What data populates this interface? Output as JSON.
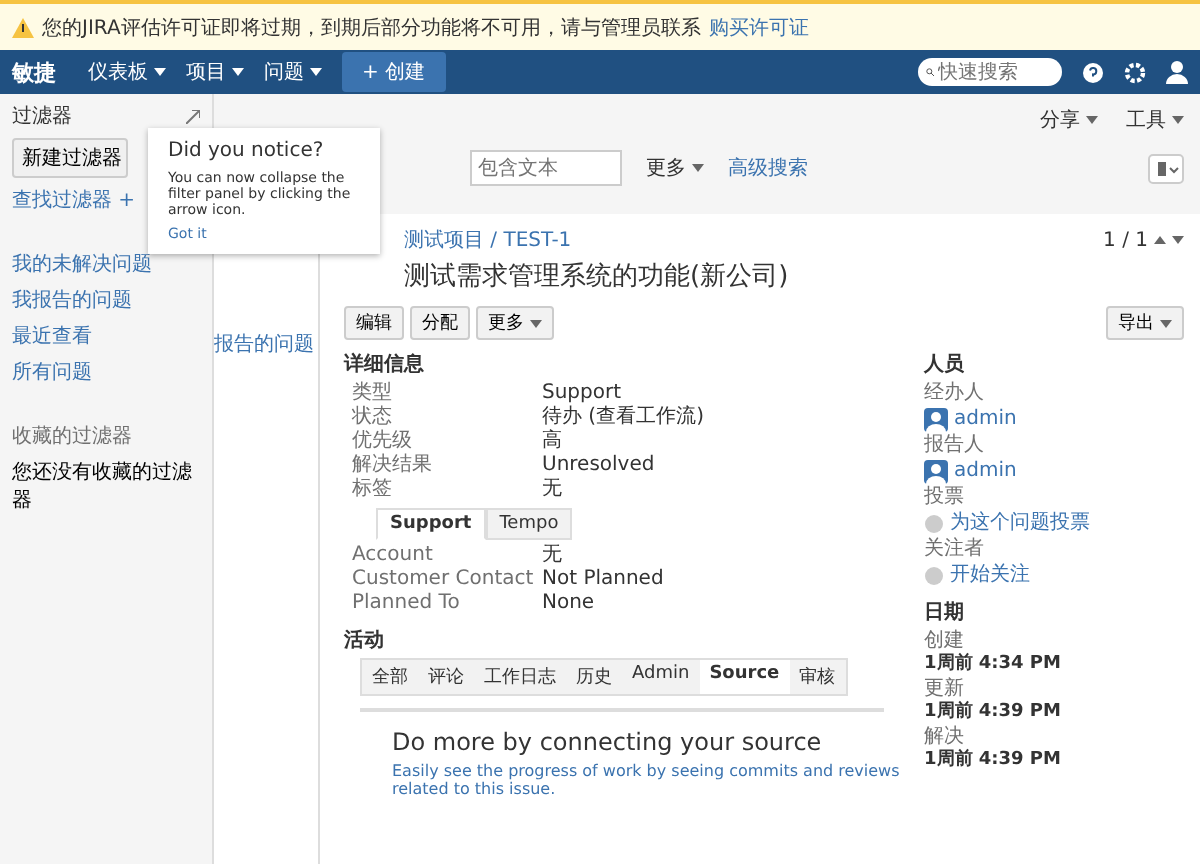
{
  "notice": {
    "text": "您的JIRA评估许可证即将过期，到期后部分功能将不可用，请与管理员联系",
    "link": "购买许可证"
  },
  "nav": {
    "logo": "敏捷",
    "menus": [
      "仪表板",
      "项目",
      "问题"
    ],
    "create": "+ 创建",
    "search": {
      "placeholder": "快速搜索"
    }
  },
  "sidebar": {
    "title": "过滤器",
    "new_button": "新建过滤器",
    "find_link": "查找过滤器 +",
    "items": [
      "我的未解决问题",
      "我报告的问题",
      "最近查看",
      "所有问题"
    ],
    "favorites_title": "收藏的过滤器",
    "favorites_empty": "您还没有收藏的过滤器"
  },
  "popup": {
    "title": "Did you notice?",
    "text": "You can now collapse the filter panel by clicking the arrow icon.",
    "link": "Got it"
  },
  "list_column": {
    "text": "报告的问题"
  },
  "toolbar": {
    "share": "分享",
    "tools": "工具",
    "search": {
      "placeholder": "包含文本"
    },
    "more": "更多",
    "advanced": "高级搜索"
  },
  "issue": {
    "breadcrumb": "测试项目 / TEST-1",
    "title": "测试需求管理系统的功能(新公司)",
    "pager": "1 / 1",
    "buttons": [
      "编辑",
      "分配",
      "更多"
    ],
    "export": "导出",
    "details_title": "详细信息",
    "fields": [
      {
        "label": "类型",
        "value": "Support"
      },
      {
        "label": "状态",
        "value": "待办 (查看工作流)"
      },
      {
        "label": "优先级",
        "value": "高"
      },
      {
        "label": "解决结果",
        "value": "Unresolved"
      },
      {
        "label": "标签",
        "value": "无"
      }
    ],
    "tabs": [
      {
        "label": "Support",
        "selected": true
      },
      {
        "label": "Tempo",
        "selected": false
      }
    ],
    "tab_fields": [
      {
        "label": "Account",
        "value": "无"
      },
      {
        "label": "Customer Contact",
        "value": "Not Planned"
      },
      {
        "label": "Planned To",
        "value": "None"
      }
    ],
    "activity_title": "活动",
    "activity_tabs": [
      {
        "label": "全部",
        "selected": false
      },
      {
        "label": "评论",
        "selected": false
      },
      {
        "label": "工作日志",
        "selected": false
      },
      {
        "label": "历史",
        "selected": false
      },
      {
        "label": "Admin",
        "selected": false
      },
      {
        "label": "Source",
        "selected": true
      },
      {
        "label": "审核",
        "selected": false
      }
    ],
    "connect_title": "Do more by connecting your source",
    "connect_text": "Easily see the progress of work by seeing commits and reviews related to this issue."
  },
  "people": {
    "title": "人员",
    "assignee_label": "经办人",
    "assignee": "admin",
    "reporter_label": "报告人",
    "reporter": "admin",
    "votes_label": "投票",
    "votes": "为这个问题投票",
    "watchers_label": "关注者",
    "watchers": "开始关注"
  },
  "dates": {
    "title": "日期",
    "items": [
      {
        "label": "创建",
        "value": "1周前 4:34 PM"
      },
      {
        "label": "更新",
        "value": "1周前 4:39 PM"
      },
      {
        "label": "解决",
        "value": "1周前 4:39 PM"
      }
    ]
  }
}
